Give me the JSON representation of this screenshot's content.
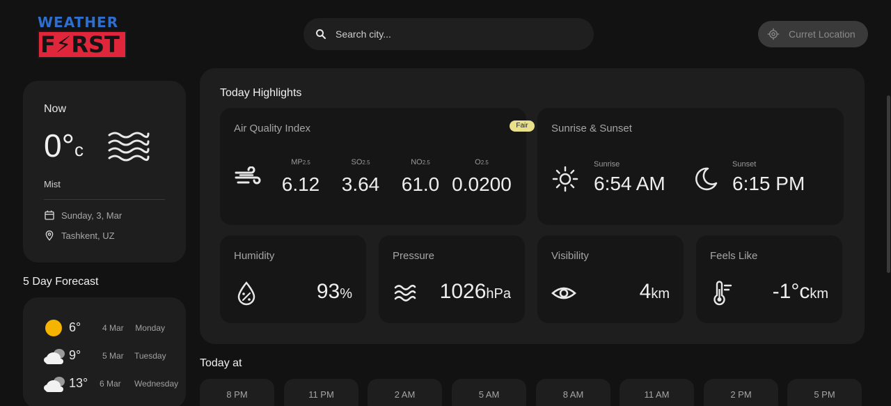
{
  "logo": {
    "top": "WEATHER",
    "bottom": "F⚡RST"
  },
  "search": {
    "placeholder": "Search city..."
  },
  "location_button": {
    "label": "Curret Location"
  },
  "now": {
    "title": "Now",
    "temp": "0°",
    "unit": "c",
    "description": "Mist",
    "date": "Sunday, 3, Mar",
    "location": "Tashkent, UZ",
    "icon": "mist-icon"
  },
  "forecast": {
    "title": "5 Day Forecast",
    "days": [
      {
        "temp": "6°",
        "date": "4 Mar",
        "weekday": "Monday",
        "icon": "sun-icon"
      },
      {
        "temp": "9°",
        "date": "5 Mar",
        "weekday": "Tuesday",
        "icon": "cloud-icon"
      },
      {
        "temp": "13°",
        "date": "6 Mar",
        "weekday": "Wednesday",
        "icon": "cloud-icon"
      }
    ]
  },
  "highlights": {
    "title": "Today Highlights",
    "aqi": {
      "label": "Air Quality Index",
      "badge": "Fair",
      "items": [
        {
          "name": "MP",
          "sub": "2.5",
          "value": "6.12"
        },
        {
          "name": "SO",
          "sub": "2.5",
          "value": "3.64"
        },
        {
          "name": "NO",
          "sub": "2.5",
          "value": "61.0"
        },
        {
          "name": "O",
          "sub": "2.5",
          "value": "0.0200"
        }
      ]
    },
    "sun": {
      "label": "Sunrise & Sunset",
      "sunrise_label": "Sunrise",
      "sunrise": "6:54 AM",
      "sunset_label": "Sunset",
      "sunset": "6:15 PM"
    },
    "humidity": {
      "label": "Humidity",
      "value": "93",
      "unit": "%"
    },
    "pressure": {
      "label": "Pressure",
      "value": "1026",
      "unit": "hPa"
    },
    "visibility": {
      "label": "Visibility",
      "value": "4",
      "unit": "km"
    },
    "feels_like": {
      "label": "Feels Like",
      "value": "-1°c",
      "unit": "km"
    }
  },
  "today": {
    "title": "Today at",
    "hours": [
      "8 PM",
      "11 PM",
      "2 AM",
      "5 AM",
      "8 AM",
      "11 AM",
      "2 PM",
      "5 PM"
    ]
  },
  "colors": {
    "accent": "#e0263a",
    "logo_blue": "#2d6fd0",
    "badge": "#e8e08a",
    "sun": "#f5b400"
  }
}
